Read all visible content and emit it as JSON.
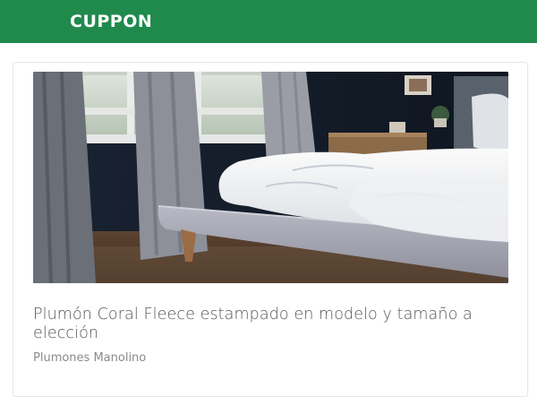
{
  "header": {
    "brand": "CUPPON",
    "background_color": "#1f8a4c"
  },
  "deal_card": {
    "image_description_icon": "bed-photo-image",
    "title": "Plumón Coral Fleece estampado en modelo y tamaño a elección",
    "merchant": "Plumones Manolino"
  }
}
